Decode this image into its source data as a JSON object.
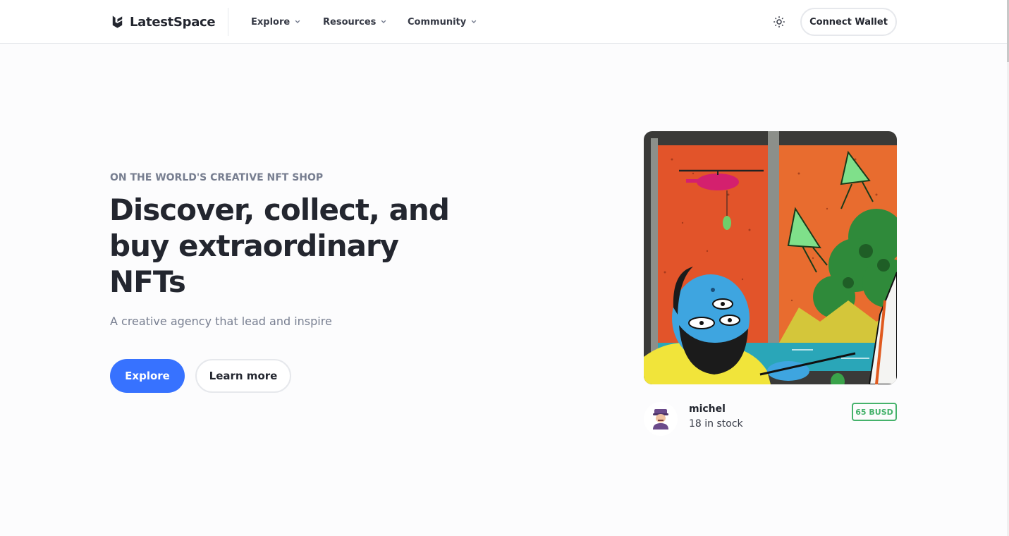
{
  "header": {
    "brand": "LatestSpace",
    "nav": [
      {
        "label": "Explore"
      },
      {
        "label": "Resources"
      },
      {
        "label": "Community"
      }
    ],
    "connect_label": "Connect Wallet",
    "icons": {
      "logo": "latestspace-logo-icon",
      "chevron": "chevron-down-icon",
      "theme": "sun-icon"
    }
  },
  "hero": {
    "eyebrow": "ON THE WORLD'S CREATIVE NFT SHOP",
    "title": "Discover, collect, and buy extraordinary NFTs",
    "subtitle": "A creative agency that lead and inspire",
    "primary_label": "Explore",
    "secondary_label": "Learn more"
  },
  "nft": {
    "owner": "michel",
    "stock": "18 in stock",
    "price": "65 BUSD"
  },
  "colors": {
    "accent": "#3772ff",
    "price_green": "#45b26b",
    "text_dark": "#23262f",
    "text_muted": "#777e90",
    "border": "#e6e8ec"
  }
}
